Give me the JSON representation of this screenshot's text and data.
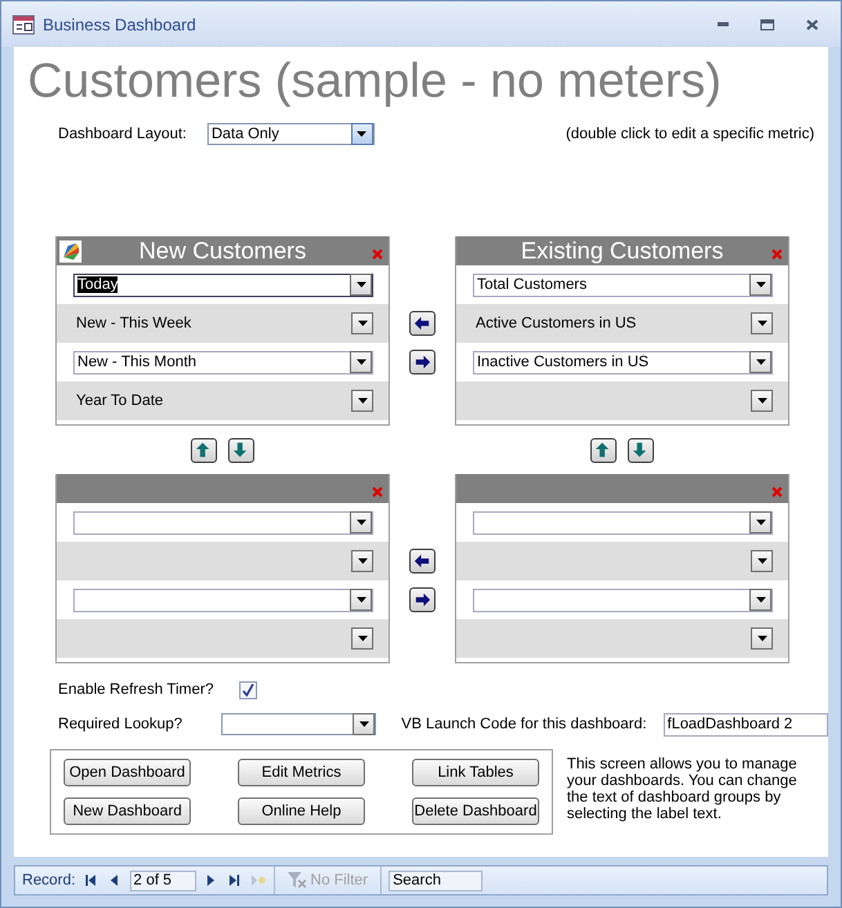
{
  "window": {
    "title": "Business Dashboard"
  },
  "heading": "Customers (sample - no meters)",
  "layout_field": {
    "label": "Dashboard Layout:",
    "value": "Data Only"
  },
  "hint": "(double click to edit a specific metric)",
  "panels": [
    {
      "title": "New Customers",
      "logo": true,
      "rows": [
        {
          "kind": "field",
          "value": "Today",
          "selected": true
        },
        {
          "kind": "plain",
          "value": "New - This Week",
          "selected": false
        },
        {
          "kind": "field",
          "value": "New - This Month",
          "selected": false
        },
        {
          "kind": "plain",
          "value": "Year To Date",
          "selected": false
        }
      ]
    },
    {
      "title": "Existing Customers",
      "logo": false,
      "rows": [
        {
          "kind": "field",
          "value": "Total Customers",
          "selected": false
        },
        {
          "kind": "plain",
          "value": "Active Customers in US",
          "selected": false
        },
        {
          "kind": "field",
          "value": "Inactive Customers in US",
          "selected": false
        },
        {
          "kind": "plain",
          "selected": false
        }
      ]
    },
    {
      "logo": false,
      "rows": [
        {
          "kind": "field",
          "selected": false
        },
        {
          "kind": "plain",
          "selected": false
        },
        {
          "kind": "field",
          "selected": false
        },
        {
          "kind": "plain",
          "selected": false
        }
      ]
    },
    {
      "logo": false,
      "rows": [
        {
          "kind": "field",
          "selected": false
        },
        {
          "kind": "plain",
          "selected": false
        },
        {
          "kind": "field",
          "selected": false
        },
        {
          "kind": "plain",
          "selected": false
        }
      ]
    }
  ],
  "refresh_timer": {
    "label": "Enable Refresh Timer?",
    "checked": true
  },
  "lookup": {
    "label": "Required Lookup?"
  },
  "vb_code": {
    "label": "VB Launch Code for this dashboard:",
    "value": "fLoadDashboard 2"
  },
  "buttons": [
    "Open Dashboard",
    "Edit Metrics",
    "Link Tables",
    "New Dashboard",
    "Online Help",
    "Delete Dashboard"
  ],
  "help_text": "This screen allows you to manage your dashboards.  You can change the text of dashboard groups by selecting the label text.",
  "record_bar": {
    "label": "Record:",
    "position": "2 of 5",
    "filter": "No Filter",
    "placeholder": "Search"
  }
}
